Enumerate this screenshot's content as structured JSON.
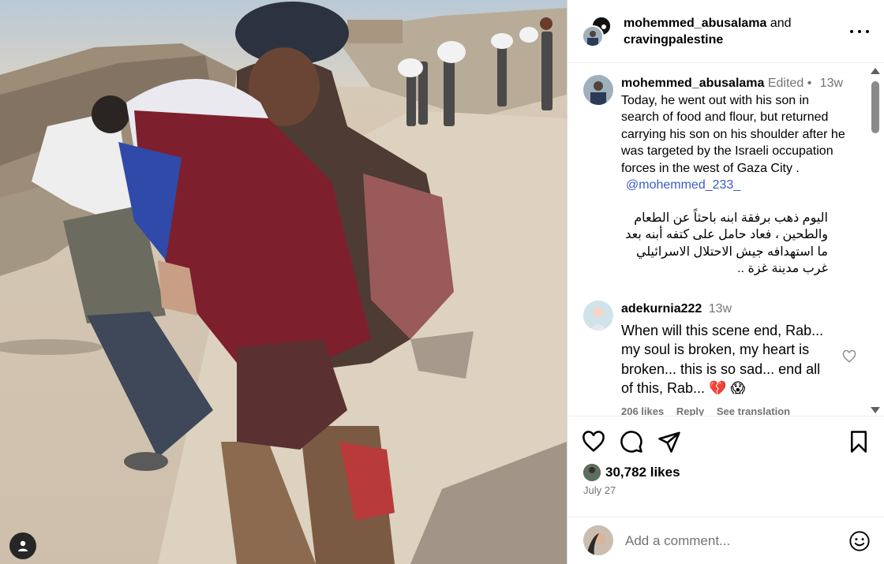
{
  "photo": {
    "alt": "Post photo"
  },
  "header": {
    "user1": "mohemmed_abusalama",
    "joiner": " and",
    "user2": "cravingpalestine"
  },
  "caption": {
    "username": "mohemmed_abusalama",
    "edited": "Edited",
    "dot": "•",
    "time": "13w",
    "text": "Today, he went out with his son in search of food and flour, but returned carrying his son on his shoulder after he was targeted by the Israeli occupation forces in the west of Gaza City .",
    "mention": "@mohemmed_233_",
    "arabic": "اليوم ذهب برفقة ابنه باحثاً عن الطعام والطحين ، فعاد حامل على كتفه أبنه بعد ما استهدافه جيش الاحتلال الاسرائيلي غرب مدينة غزة .."
  },
  "comment1": {
    "username": "adekurnia222",
    "time": "13w",
    "text": "When will this scene end, Rab... my soul is broken, my heart is broken... this is so sad... end all of this, Rab...",
    "emojis": "💔 😱",
    "likes": "206 likes",
    "reply": "Reply",
    "translate": "See translation"
  },
  "post": {
    "likes": "30,782 likes",
    "date": "July 27"
  },
  "add_comment": {
    "placeholder": "Add a comment..."
  },
  "colors": {
    "link": "#3b5bc4",
    "meta": "#737373"
  }
}
